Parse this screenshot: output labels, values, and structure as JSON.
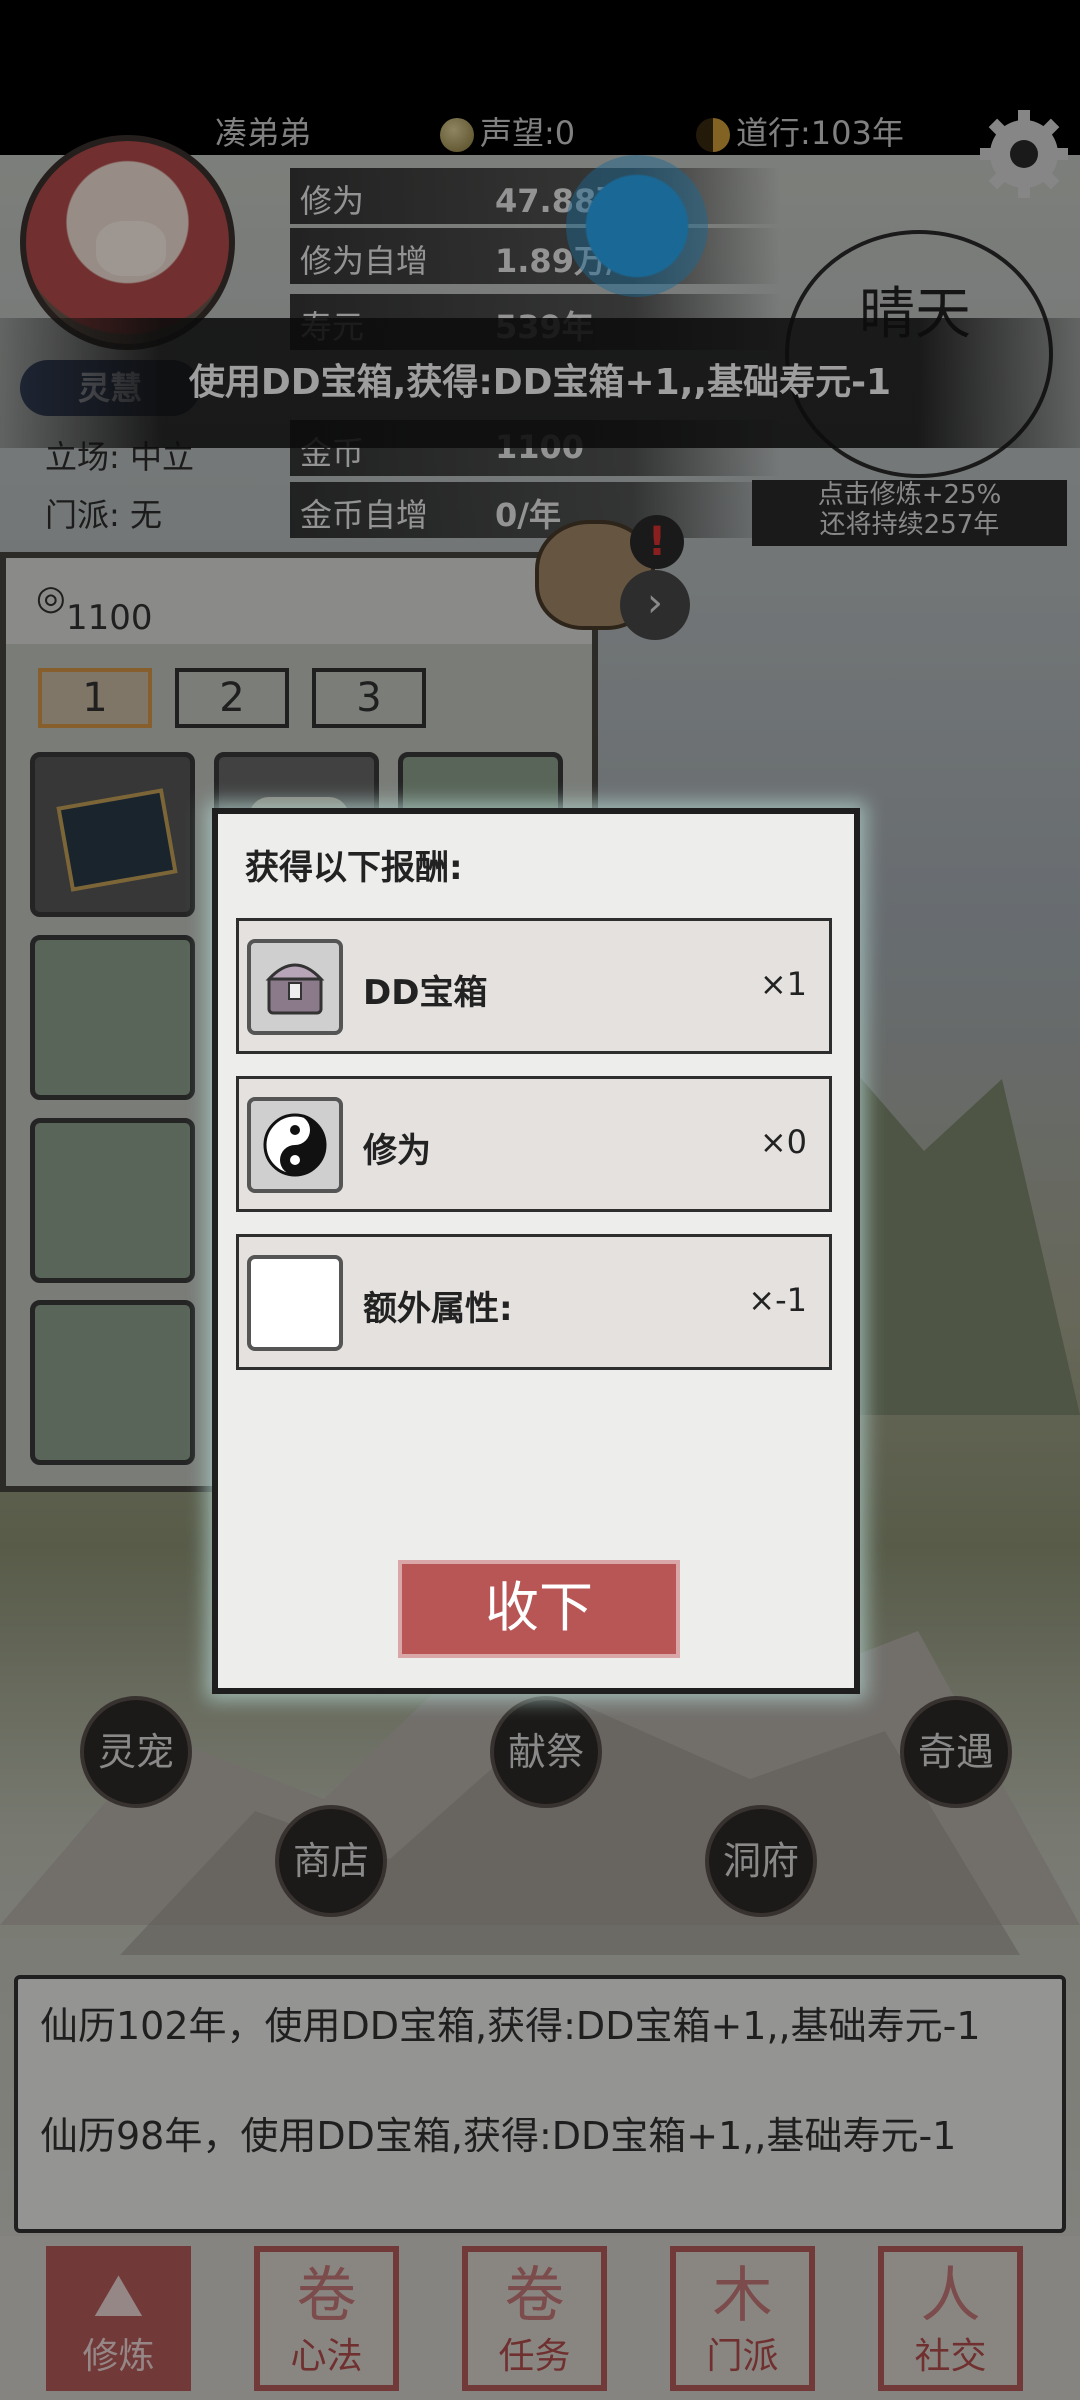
{
  "header": {
    "player_name": "凑弟弟",
    "reputation": "声望:0",
    "dao_years": "道行:103年"
  },
  "stats": [
    {
      "label": "修为",
      "value": "47.88万"
    },
    {
      "label": "修为自增",
      "value": "1.89万/年"
    },
    {
      "label": "寿元",
      "value": "539年"
    },
    {
      "label": "金币",
      "value": "1100"
    },
    {
      "label": "金币自增",
      "value": "0/年"
    }
  ],
  "left_info": {
    "badge": "灵慧",
    "stance": "立场: 中立",
    "sect": "门派: 无"
  },
  "weather": {
    "label": "晴天",
    "boost_line1": "点击修炼+25%",
    "boost_line2": "还将持续257年"
  },
  "toast": "使用DD宝箱,获得:DD宝箱+1,,基础寿元-1",
  "inventory": {
    "gold": "1100",
    "tabs": [
      "1",
      "2",
      "3"
    ],
    "active_tab": "1"
  },
  "round_buttons": [
    "灵宠",
    "献祭",
    "奇遇",
    "商店",
    "洞府"
  ],
  "log": [
    "仙历102年，使用DD宝箱,获得:DD宝箱+1,,基础寿元-1",
    "仙历98年，使用DD宝箱,获得:DD宝箱+1,,基础寿元-1"
  ],
  "bottom_nav": [
    {
      "label": "修炼",
      "icon": "mountain-icon",
      "active": true
    },
    {
      "label": "心法",
      "icon": "scroll-icon",
      "active": false
    },
    {
      "label": "任务",
      "icon": "task-scroll-icon",
      "active": false
    },
    {
      "label": "门派",
      "icon": "sect-icon",
      "active": false
    },
    {
      "label": "社交",
      "icon": "people-icon",
      "active": false
    }
  ],
  "dialog": {
    "title": "获得以下报酬:",
    "rewards": [
      {
        "name": "DD宝箱",
        "qty": "×1",
        "icon": "treasure-chest-icon"
      },
      {
        "name": "修为",
        "qty": "×0",
        "icon": "yin-yang-icon"
      },
      {
        "name": "额外属性:",
        "qty": "×-1",
        "icon": "blank-icon"
      }
    ],
    "confirm_label": "收下"
  },
  "colors": {
    "accent_red": "#b85656",
    "touch_blue": "#2aa8f0"
  }
}
